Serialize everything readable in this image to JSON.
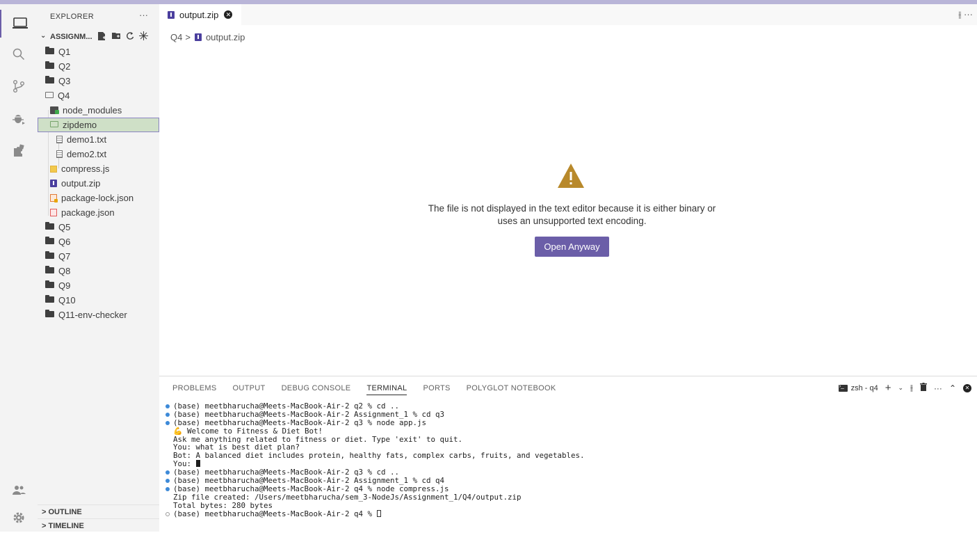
{
  "sidebar": {
    "header": "EXPLORER",
    "more": "···",
    "root_folder": "ASSIGNM...",
    "items": [
      {
        "label": "Q1",
        "kind": "folder"
      },
      {
        "label": "Q2",
        "kind": "folder"
      },
      {
        "label": "Q3",
        "kind": "folder"
      },
      {
        "label": "Q4",
        "kind": "folder-open"
      },
      {
        "label": "node_modules",
        "kind": "node-modules"
      },
      {
        "label": "zipdemo",
        "kind": "folder-open-selected"
      },
      {
        "label": "demo1.txt",
        "kind": "txt"
      },
      {
        "label": "demo2.txt",
        "kind": "txt"
      },
      {
        "label": "compress.js",
        "kind": "js"
      },
      {
        "label": "output.zip",
        "kind": "zip"
      },
      {
        "label": "package-lock.json",
        "kind": "lock-json"
      },
      {
        "label": "package.json",
        "kind": "json"
      },
      {
        "label": "Q5",
        "kind": "folder"
      },
      {
        "label": "Q6",
        "kind": "folder"
      },
      {
        "label": "Q7",
        "kind": "folder"
      },
      {
        "label": "Q8",
        "kind": "folder"
      },
      {
        "label": "Q9",
        "kind": "folder"
      },
      {
        "label": "Q10",
        "kind": "folder"
      },
      {
        "label": "Q11-env-checker",
        "kind": "folder"
      }
    ],
    "outline": "OUTLINE",
    "timeline": "TIMELINE"
  },
  "editor": {
    "tab_label": "output.zip",
    "breadcrumb": {
      "folder": "Q4",
      "sep": ">",
      "file": "output.zip"
    },
    "message_line1": "The file is not displayed in the text editor because it is either binary or",
    "message_line2": "uses an unsupported text encoding.",
    "open_button": "Open Anyway",
    "warning_color": "#b8892b",
    "accent_color": "#6b5ea8"
  },
  "panel": {
    "tabs": [
      "PROBLEMS",
      "OUTPUT",
      "DEBUG CONSOLE",
      "TERMINAL",
      "PORTS",
      "POLYGLOT NOTEBOOK"
    ],
    "active_tab": "TERMINAL",
    "terminal_name": "zsh - q4",
    "terminal_lines": [
      {
        "dot": "blue",
        "text": "(base) meetbharucha@Meets-MacBook-Air-2 q2 % cd .."
      },
      {
        "dot": "blue",
        "text": "(base) meetbharucha@Meets-MacBook-Air-2 Assignment_1 % cd q3"
      },
      {
        "dot": "blue",
        "text": "(base) meetbharucha@Meets-MacBook-Air-2 q3 % node app.js"
      },
      {
        "dot": "",
        "text": "💪 Welcome to Fitness & Diet Bot!"
      },
      {
        "dot": "",
        "text": "Ask me anything related to fitness or diet. Type 'exit' to quit."
      },
      {
        "dot": "",
        "text": "You: what is best diet plan?"
      },
      {
        "dot": "",
        "text": "Bot: A balanced diet includes protein, healthy fats, complex carbs, fruits, and vegetables."
      },
      {
        "dot": "",
        "text": "You: ",
        "cursor": "solid"
      },
      {
        "dot": "blue",
        "text": "(base) meetbharucha@Meets-MacBook-Air-2 q3 % cd .."
      },
      {
        "dot": "blue",
        "text": "(base) meetbharucha@Meets-MacBook-Air-2 Assignment_1 % cd q4"
      },
      {
        "dot": "blue",
        "text": "(base) meetbharucha@Meets-MacBook-Air-2 q4 % node compress.js"
      },
      {
        "dot": "",
        "text": "Zip file created: /Users/meetbharucha/sem_3-NodeJs/Assignment_1/Q4/output.zip"
      },
      {
        "dot": "",
        "text": "Total bytes: 280 bytes"
      },
      {
        "dot": "hollow",
        "text": "(base) meetbharucha@Meets-MacBook-Air-2 q4 % ",
        "cursor": "outline"
      }
    ]
  }
}
